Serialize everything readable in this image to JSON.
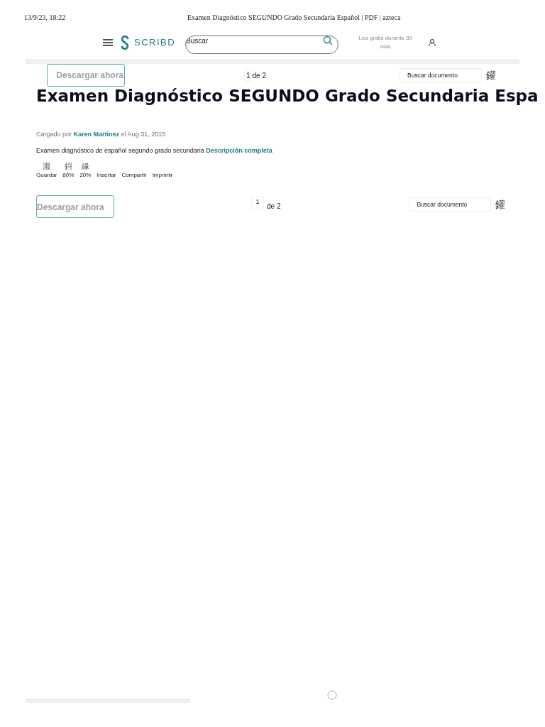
{
  "print_header": {
    "date": "13/9/23, 18:22",
    "title": "Examen Diagnóstico SEGUNDO Grado Secundaria Español | PDF | azteca"
  },
  "nav": {
    "logo": "SCRIBD",
    "search": {
      "placeholder": "Buscar"
    },
    "promo": "Lea gratis durante 30 días"
  },
  "toolbar_top": {
    "download": "Descargar ahora",
    "page": "1",
    "page_total": "de 2",
    "search": {
      "placeholder": "Buscar documento"
    },
    "glyph": "鑵"
  },
  "document": {
    "title": "Examen Diagnóstico SEGUNDO Grado Secundaria Espa",
    "uploaded_prefix": "Cargado por",
    "author": "Karen Martinez",
    "uploaded_suffix": "el Aug 31, 2015",
    "description": "Examen diagnóstico de español segundo grado secundaria",
    "description_link": "Descripción completa"
  },
  "actions": [
    {
      "glyph": "濺",
      "label": "Guardar"
    },
    {
      "glyph": "鋝",
      "label": "80%"
    },
    {
      "glyph": "緣",
      "label": "20%"
    },
    {
      "label": "Insertar"
    },
    {
      "label": "Compartir"
    },
    {
      "label": "Imprimir"
    }
  ],
  "toolbar_bottom": {
    "download": "Descargar ahora",
    "page": "1",
    "page_total": "de 2",
    "search": {
      "placeholder": "Buscar documento"
    },
    "glyph": "鑵"
  }
}
